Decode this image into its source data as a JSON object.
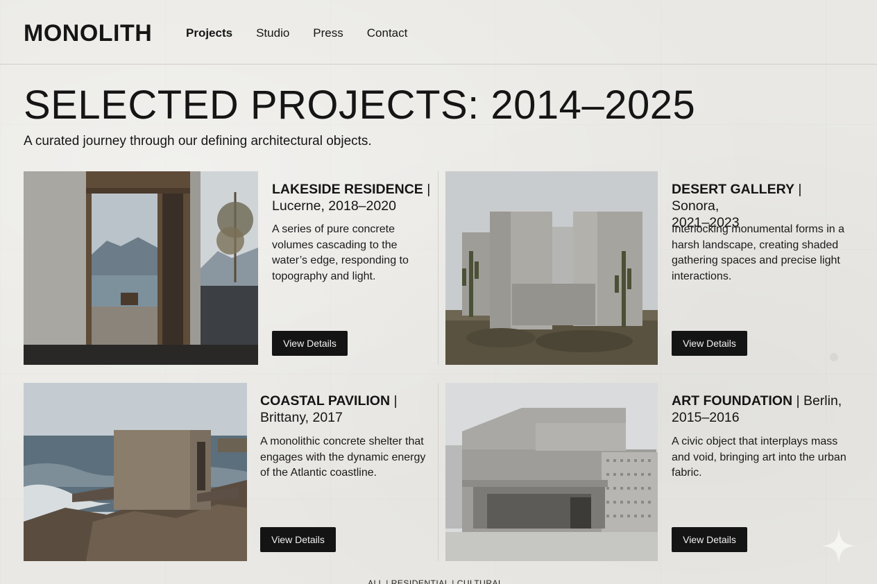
{
  "brand": {
    "logo": "MONOLITH"
  },
  "nav": {
    "items": [
      {
        "label": "Projects",
        "active": true
      },
      {
        "label": "Studio",
        "active": false
      },
      {
        "label": "Press",
        "active": false
      },
      {
        "label": "Contact",
        "active": false
      }
    ]
  },
  "hero": {
    "title": "SELECTED PROJECTS: 2014–2025",
    "subtitle": "A curated journey through our defining architectural objects."
  },
  "projects": [
    {
      "name": "LAKESIDE RESIDENCE",
      "meta_line1": " |",
      "meta_line2": "Lucerne, 2018–2020",
      "description": "A series of pure concrete volumes cascading to the water’s edge, responding to topography and light.",
      "button": "View Details"
    },
    {
      "name": "DESERT GALLERY",
      "meta_line1": " | Sonora,",
      "meta_line2": "2021–2023",
      "description": "Interlocking monumental forms in a harsh landscape, creating shaded gathering spaces and precise light interactions.",
      "button": "View Details"
    },
    {
      "name": "COASTAL PAVILION",
      "meta_line1": " |",
      "meta_line2": "Brittany, 2017",
      "description": "A monolithic concrete shelter that engages with the dynamic energy of the Atlantic coastline.",
      "button": "View Details"
    },
    {
      "name": "ART FOUNDATION",
      "meta_line1": " | Berlin,",
      "meta_line2": "2015–2016",
      "description": "A civic object that interplays mass and void, bringing art into the urban fabric.",
      "button": "View Details"
    }
  ],
  "footer": {
    "filters": "ALL | RESIDENTIAL | CULTURAL"
  },
  "colors": {
    "background": "#e9e8e4",
    "text": "#151515",
    "button": "#141414"
  }
}
